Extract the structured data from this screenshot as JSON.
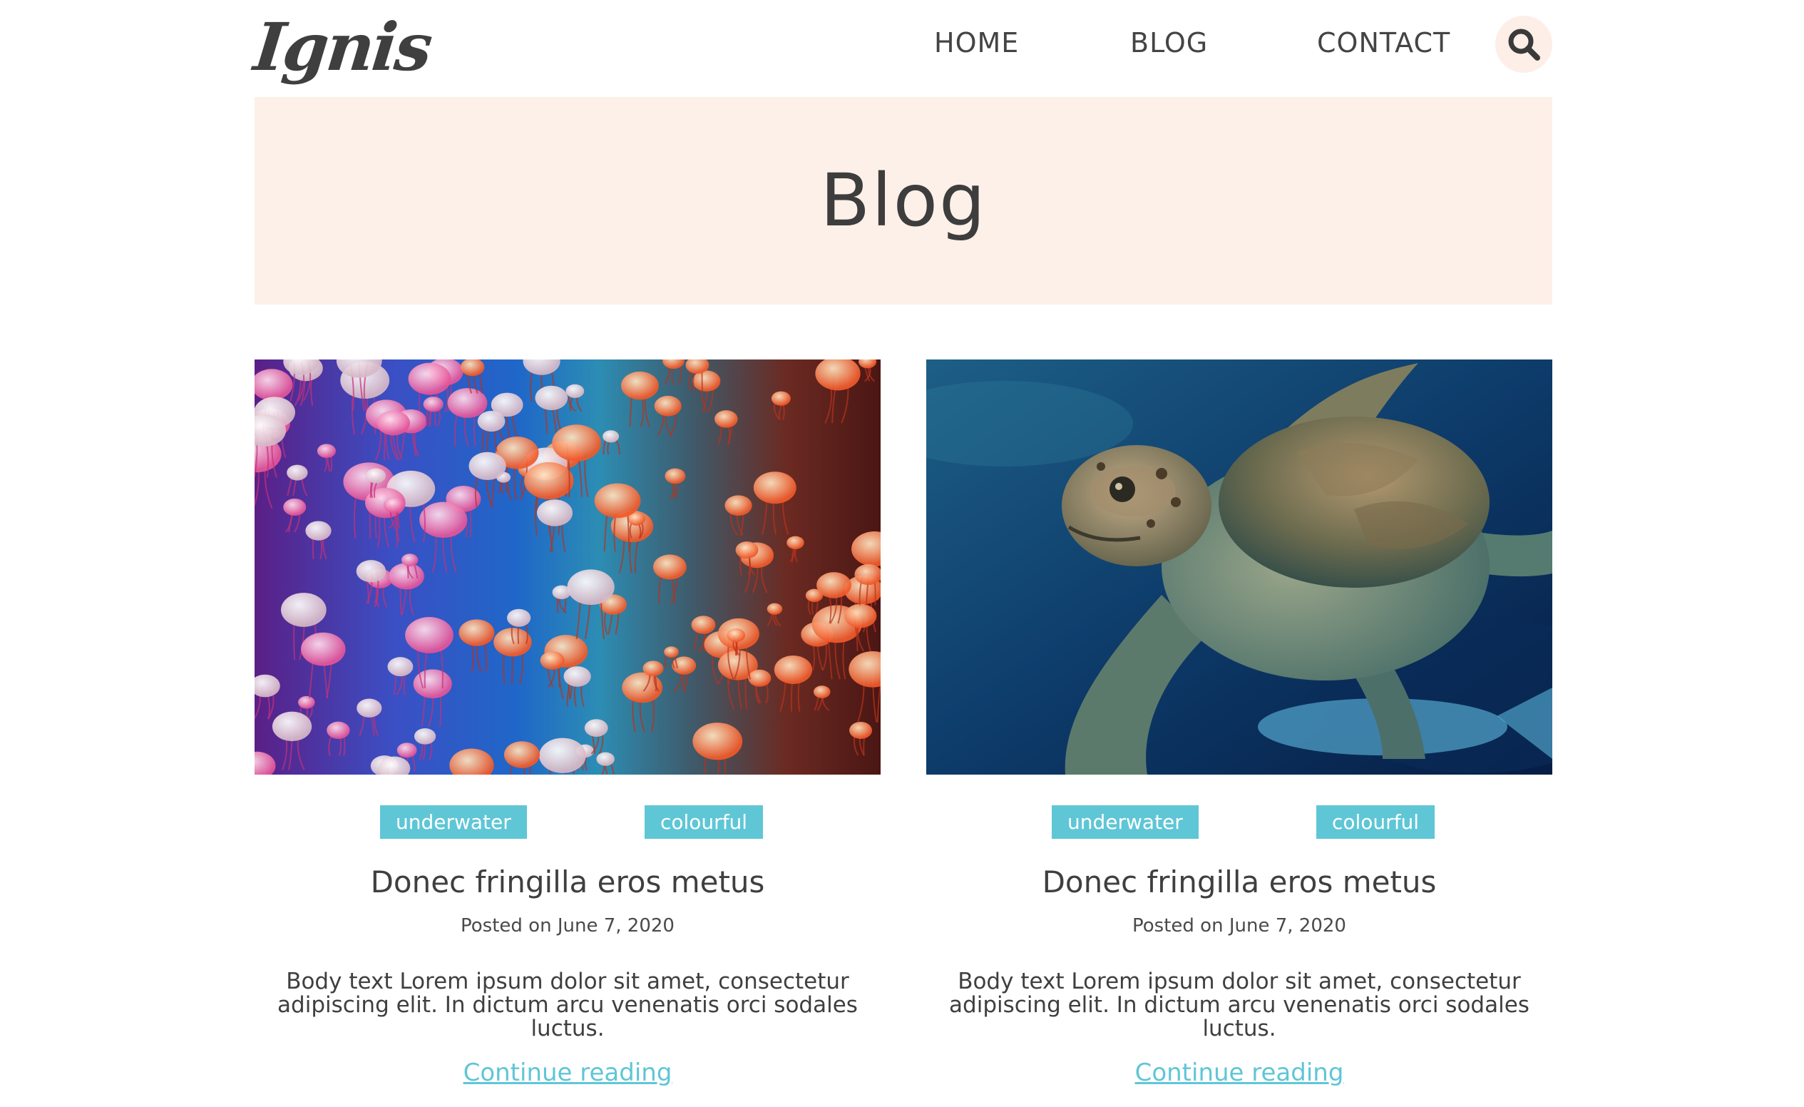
{
  "header": {
    "logo": "Ignis",
    "nav": {
      "home": "HOME",
      "blog": "BLOG",
      "contact": "CONTACT"
    }
  },
  "hero": {
    "title": "Blog"
  },
  "posts": [
    {
      "image_alt": "jellyfish",
      "tags": [
        "underwater",
        "colourful"
      ],
      "title": "Donec fringilla eros metus",
      "date": "Posted on June 7, 2020",
      "body_line1": "Body text Lorem ipsum dolor sit amet, consectetur",
      "body_line2": "adipiscing elit. In dictum arcu venenatis orci sodales luctus.",
      "cta": "Continue reading"
    },
    {
      "image_alt": "sea turtle",
      "tags": [
        "underwater",
        "colourful"
      ],
      "title": "Donec fringilla eros metus",
      "date": "Posted on June 7, 2020",
      "body_line1": "Body text Lorem ipsum dolor sit amet, consectetur",
      "body_line2": "adipiscing elit. In dictum arcu venenatis orci sodales luctus.",
      "cta": "Continue reading"
    }
  ],
  "colors": {
    "accent": "#5fc6d6",
    "hero_bg": "#fdf0e9",
    "search_bg": "#fdeee7",
    "text": "#444444"
  },
  "icons": {
    "search": "search-icon"
  }
}
